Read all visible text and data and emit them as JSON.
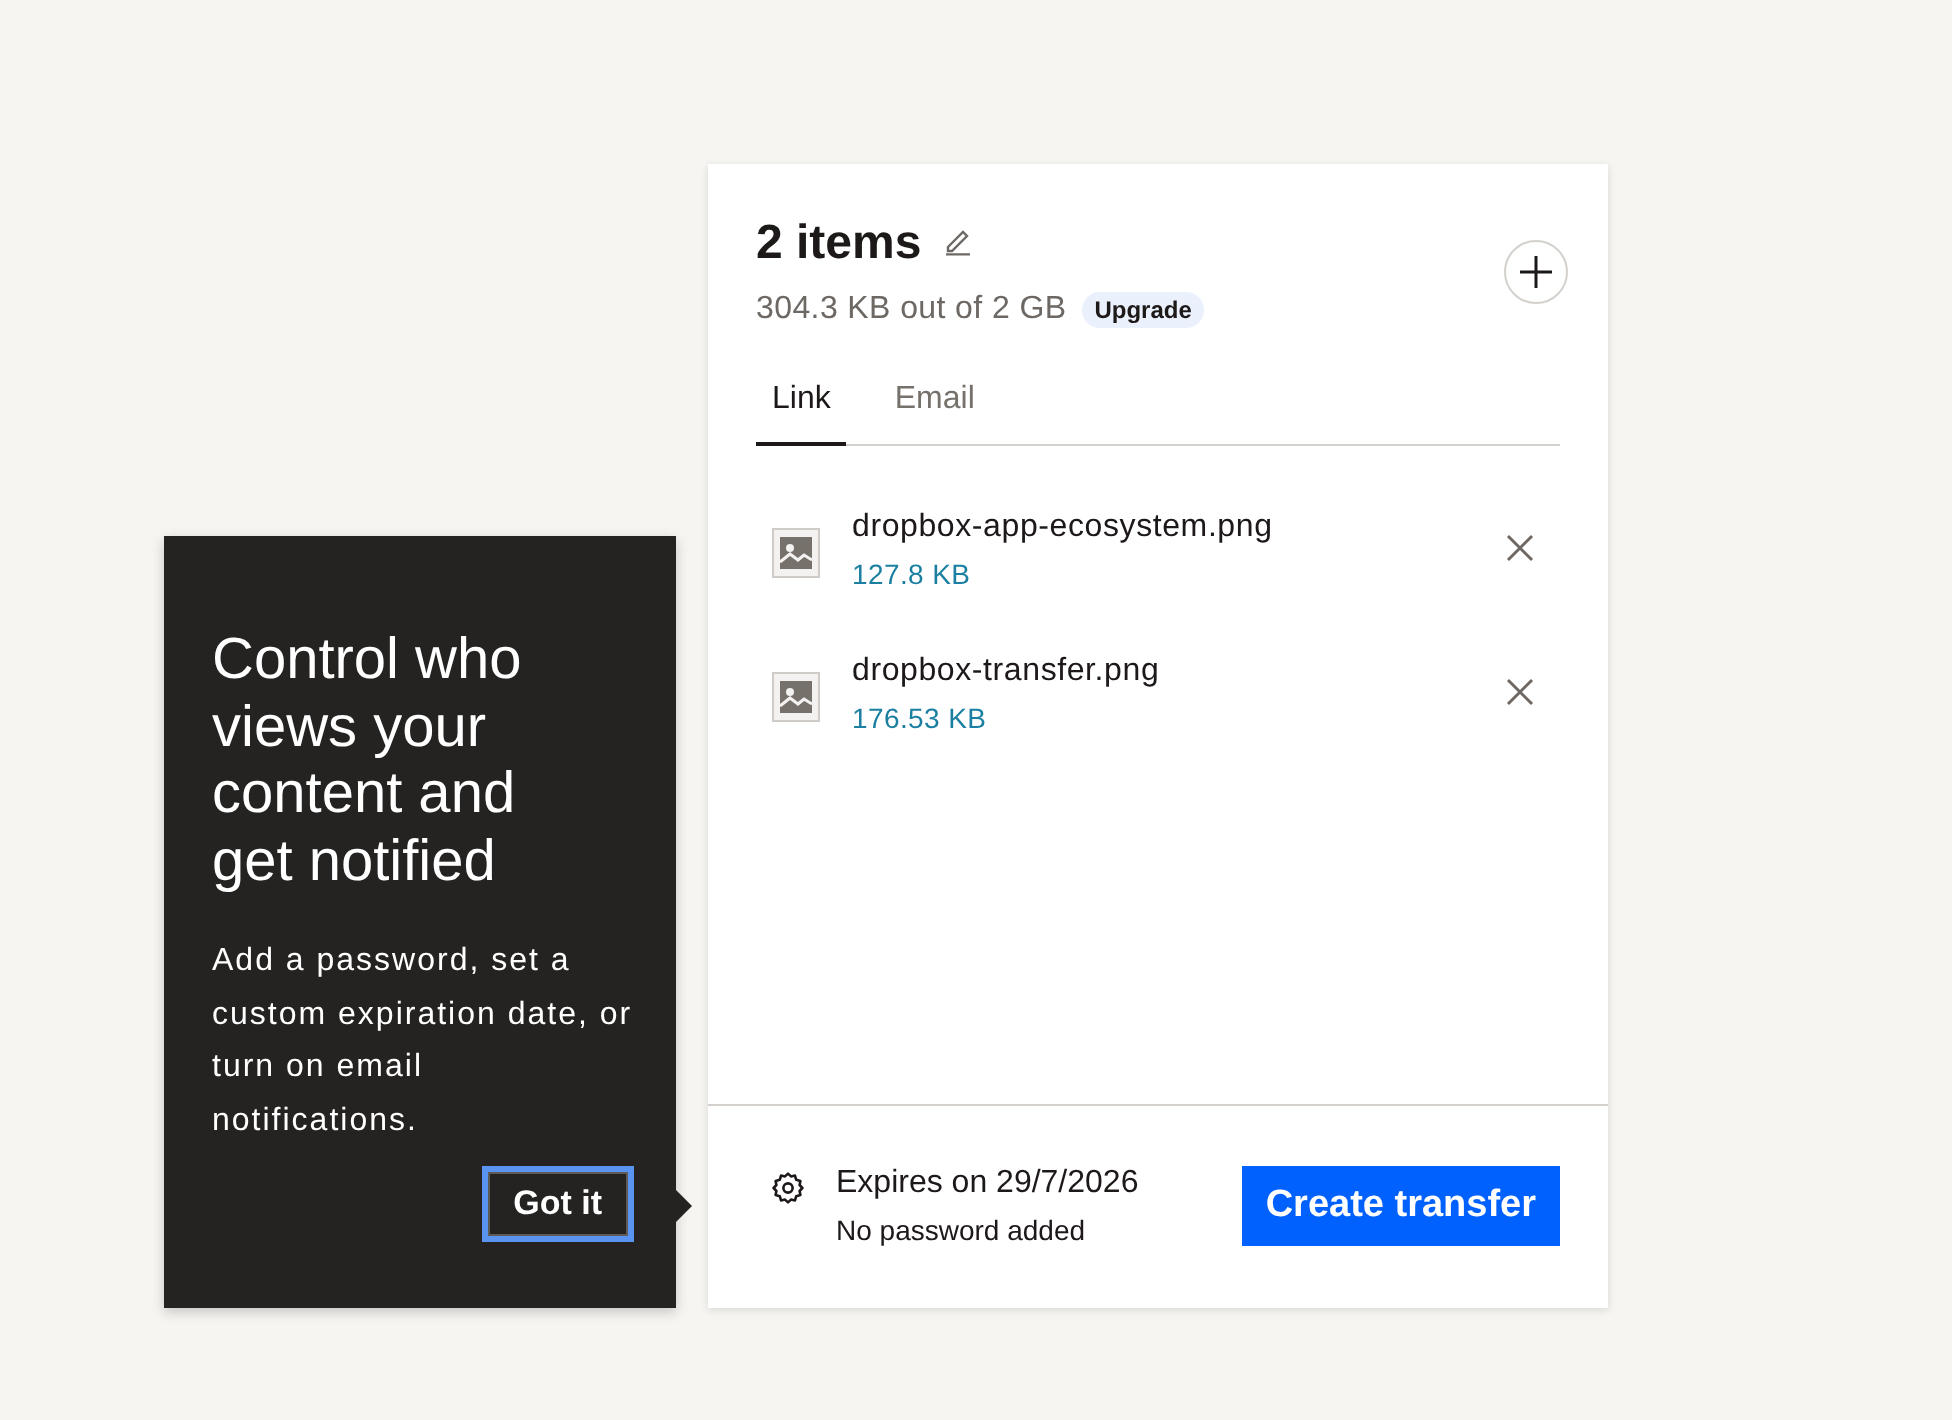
{
  "panel": {
    "title": "2 items",
    "usage": "304.3 KB out of 2 GB",
    "upgrade_badge": "Upgrade"
  },
  "tabs": [
    {
      "label": "Link",
      "selected": true
    },
    {
      "label": "Email",
      "selected": false
    }
  ],
  "files": [
    {
      "name": "dropbox-app-ecosystem.png",
      "size": "127.8 KB"
    },
    {
      "name": "dropbox-transfer.png",
      "size": "176.53 KB"
    }
  ],
  "footer": {
    "expiry": "Expires on 29/7/2026",
    "password_status": "No password added",
    "button": "Create transfer"
  },
  "tooltip": {
    "title": "Control who views your content and get notified",
    "body": "Add a password, set a custom expiration date, or turn on email notifications.",
    "button": "Got it",
    "focused": true
  }
}
